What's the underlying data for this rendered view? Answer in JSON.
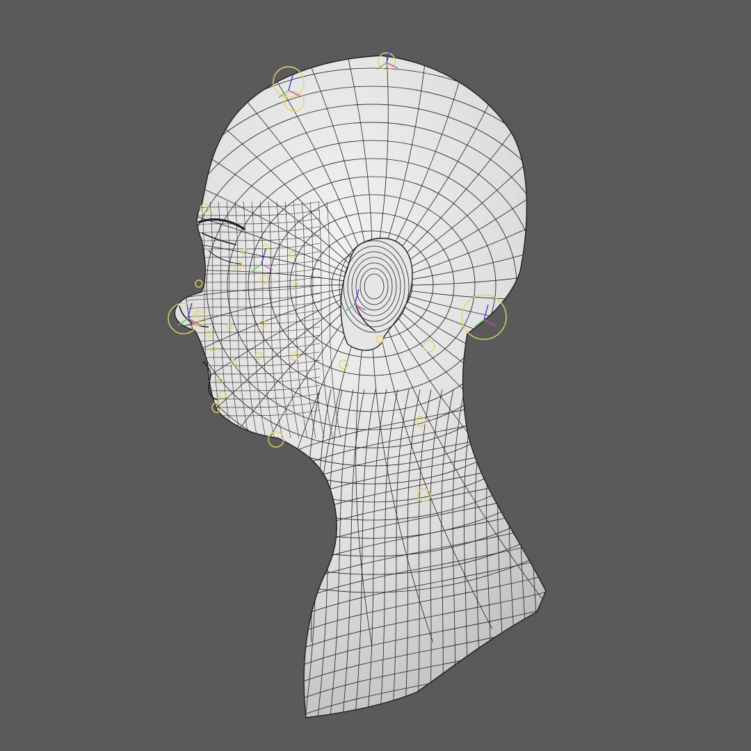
{
  "viewport": {
    "background_color": "#5a5a5a",
    "mesh_fill_color": "#e2e2e2",
    "mesh_shade_color": "#bdbdbd",
    "wire_color": "#1e1e1e",
    "rig_control_color": "#e2d36a",
    "rig_axis_colors": [
      "#3a3ad0",
      "#5cc85c",
      "#c050c0"
    ]
  },
  "model": {
    "icon": "head-bust-icon",
    "view": "side-profile-left",
    "display_mode": "wireframe-on-shaded"
  },
  "rig": {
    "icon": "facial-rig-control-icon"
  }
}
